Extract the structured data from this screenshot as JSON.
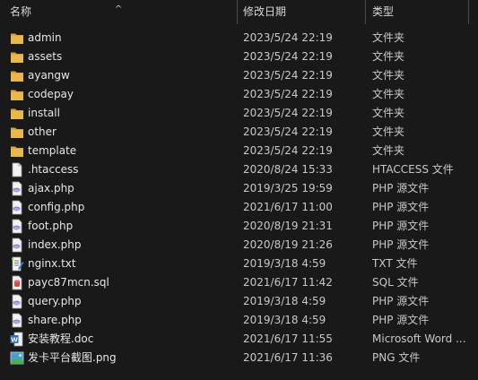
{
  "header": {
    "name": "名称",
    "date": "修改日期",
    "type": "类型",
    "sort": "^"
  },
  "files": [
    {
      "name": "admin",
      "date": "2023/5/24 22:19",
      "type": "文件夹",
      "icon": "folder"
    },
    {
      "name": "assets",
      "date": "2023/5/24 22:19",
      "type": "文件夹",
      "icon": "folder"
    },
    {
      "name": "ayangw",
      "date": "2023/5/24 22:19",
      "type": "文件夹",
      "icon": "folder"
    },
    {
      "name": "codepay",
      "date": "2023/5/24 22:19",
      "type": "文件夹",
      "icon": "folder"
    },
    {
      "name": "install",
      "date": "2023/5/24 22:19",
      "type": "文件夹",
      "icon": "folder"
    },
    {
      "name": "other",
      "date": "2023/5/24 22:19",
      "type": "文件夹",
      "icon": "folder"
    },
    {
      "name": "template",
      "date": "2023/5/24 22:19",
      "type": "文件夹",
      "icon": "folder"
    },
    {
      "name": ".htaccess",
      "date": "2020/8/24 15:33",
      "type": "HTACCESS 文件",
      "icon": "blank-file"
    },
    {
      "name": "ajax.php",
      "date": "2019/3/25 19:59",
      "type": "PHP 源文件",
      "icon": "php-file"
    },
    {
      "name": "config.php",
      "date": "2021/6/17 11:00",
      "type": "PHP 源文件",
      "icon": "php-file"
    },
    {
      "name": "foot.php",
      "date": "2020/8/19 21:31",
      "type": "PHP 源文件",
      "icon": "php-file"
    },
    {
      "name": "index.php",
      "date": "2020/8/19 21:26",
      "type": "PHP 源文件",
      "icon": "php-file"
    },
    {
      "name": "nginx.txt",
      "date": "2019/3/18 4:59",
      "type": "TXT 文件",
      "icon": "txt-file"
    },
    {
      "name": "payc87mcn.sql",
      "date": "2021/6/17 11:42",
      "type": "SQL 文件",
      "icon": "sql-file"
    },
    {
      "name": "query.php",
      "date": "2019/3/18 4:59",
      "type": "PHP 源文件",
      "icon": "php-file"
    },
    {
      "name": "share.php",
      "date": "2019/3/18 4:59",
      "type": "PHP 源文件",
      "icon": "php-file"
    },
    {
      "name": "安装教程.doc",
      "date": "2021/6/17 11:55",
      "type": "Microsoft Word ...",
      "icon": "word-file"
    },
    {
      "name": "发卡平台截图.png",
      "date": "2021/6/17 11:36",
      "type": "PNG 文件",
      "icon": "image-file"
    }
  ],
  "colors": {
    "background": "#191919",
    "folder": "#e8b84a",
    "php": "#8a7fd6",
    "sql": "#d94a4a",
    "word": "#2b6fd0",
    "image": "#3fa0e0"
  }
}
